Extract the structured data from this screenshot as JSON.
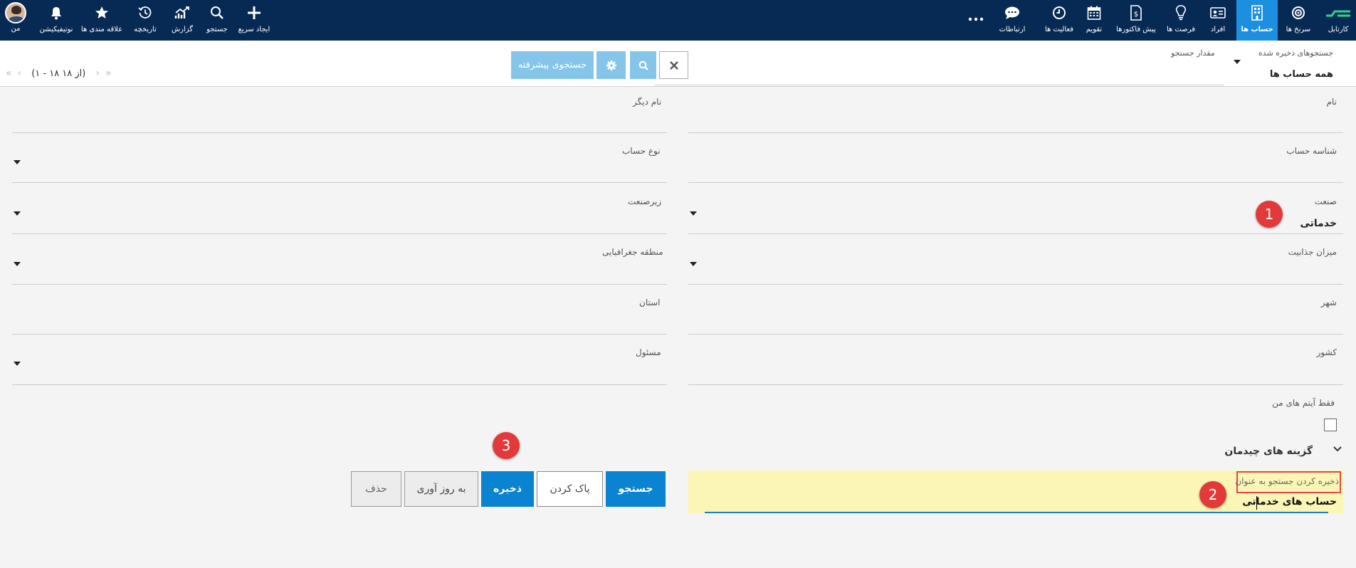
{
  "nav": {
    "items": [
      {
        "key": "cartable",
        "label": "کارتابل",
        "icon": "logo-icon"
      },
      {
        "key": "kpi",
        "label": "سرنخ ها",
        "icon": "target-icon"
      },
      {
        "key": "accounts",
        "label": "حساب ها",
        "icon": "building-icon",
        "active": true
      },
      {
        "key": "people",
        "label": "افراد",
        "icon": "id-card-icon"
      },
      {
        "key": "opportunities",
        "label": "فرصت ها",
        "icon": "lightbulb-icon"
      },
      {
        "key": "quotes",
        "label": "پیش فاکتورها",
        "icon": "document-dollar-icon"
      },
      {
        "key": "calendar",
        "label": "تقویم",
        "icon": "calendar-icon"
      },
      {
        "key": "activities",
        "label": "فعالیت ها",
        "icon": "clock-icon"
      },
      {
        "key": "communications",
        "label": "ارتباطات",
        "icon": "chat-icon"
      },
      {
        "key": "more",
        "label": "...",
        "icon": "more-icon"
      },
      {
        "key": "quick_create",
        "label": "ایجاد سریع",
        "icon": "plus-icon"
      },
      {
        "key": "search",
        "label": "جستجو",
        "icon": "search-icon"
      },
      {
        "key": "report",
        "label": "گزارش",
        "icon": "chart-icon"
      },
      {
        "key": "history",
        "label": "تاریخچه",
        "icon": "history-icon"
      },
      {
        "key": "favorites",
        "label": "علاقه مندی ها",
        "icon": "star-icon"
      },
      {
        "key": "notifications",
        "label": "نوتیفیکیشن",
        "icon": "bell-icon"
      },
      {
        "key": "me",
        "label": "من",
        "icon": "avatar"
      }
    ]
  },
  "searchbar": {
    "saved_label": "جستجوهای ذخیره شده",
    "saved_value": "همه حساب ها",
    "query_label": "مقدار جستجو",
    "advanced_label": "جستجوی پیشرفته",
    "pager_info": "(۱ - ۱۸ از ۱۸)"
  },
  "form": {
    "name_label": "نام",
    "other_name_label": "نام دیگر",
    "account_id_label": "شناسه حساب",
    "account_type_label": "نوع حساب",
    "industry_label": "صنعت",
    "industry_value": "خدماتی",
    "subindustry_label": "زیرصنعت",
    "attractiveness_label": "میزان جذابیت",
    "region_label": "منطقه جغرافیایی",
    "city_label": "شهر",
    "province_label": "استان",
    "country_label": "کشور",
    "owner_label": "مسئول",
    "my_items_label": "فقط آیتم های من",
    "layout_title": "گزینه های چیدمان",
    "save_as_label": "ذخیره کردن جستجو به عنوان",
    "save_as_value": "حساب های خدماتی"
  },
  "actions": {
    "search": "جستجو",
    "clear": "پاک کردن",
    "save": "ذخیره",
    "update": "به روز آوری",
    "delete": "حذف"
  },
  "badges": {
    "one": "1",
    "two": "2",
    "three": "3"
  },
  "colors": {
    "nav_bg": "#072a55",
    "active_tab": "#1d8fe0",
    "primary_button": "#0a84d0",
    "highlight": "#fbf6b5",
    "badge": "#e23a3a"
  }
}
